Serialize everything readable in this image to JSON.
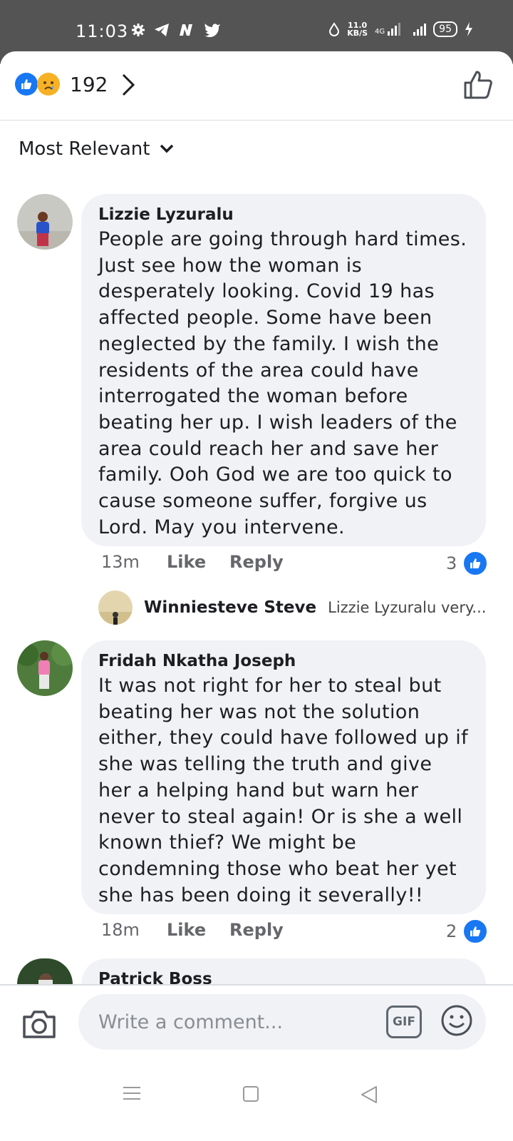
{
  "status_bar": {
    "time": "11:03",
    "net_speed_value": "11.0",
    "net_speed_unit": "KB/S",
    "network": "4G",
    "battery": "95"
  },
  "reactions": {
    "count": "192",
    "like_color": "#1877f2",
    "sad_color": "#f7b125"
  },
  "sort": {
    "label": "Most Relevant"
  },
  "comments": [
    {
      "author": "Lizzie Lyzuralu",
      "text": "People are going through hard times. Just see how the woman is desperately looking. Covid 19 has affected people. Some have been neglected by the family. I wish the residents of the area could have interrogated the woman before beating her up. I wish leaders of the area could reach her and save her family. Ooh God we are too quick to cause someone suffer, forgive us Lord. May you intervene.",
      "time": "13m",
      "like": "Like",
      "reply": "Reply",
      "likes": "3"
    },
    {
      "author": "Fridah Nkatha Joseph",
      "text": "It was not right for her to steal but beating her was not the solution either, they could have followed up if she was telling the truth and give her a helping hand but warn her never to steal again! Or is she a well known thief? We might be condemning those who beat her yet she has been doing it severally!!",
      "time": "18m",
      "like": "Like",
      "reply": "Reply",
      "likes": "2"
    },
    {
      "author": "Patrick Boss"
    }
  ],
  "reply_preview": {
    "author": "Winniesteve Steve",
    "text": "Lizzie Lyzuralu very..."
  },
  "composer": {
    "placeholder": "Write a comment...",
    "gif_label": "GIF"
  }
}
